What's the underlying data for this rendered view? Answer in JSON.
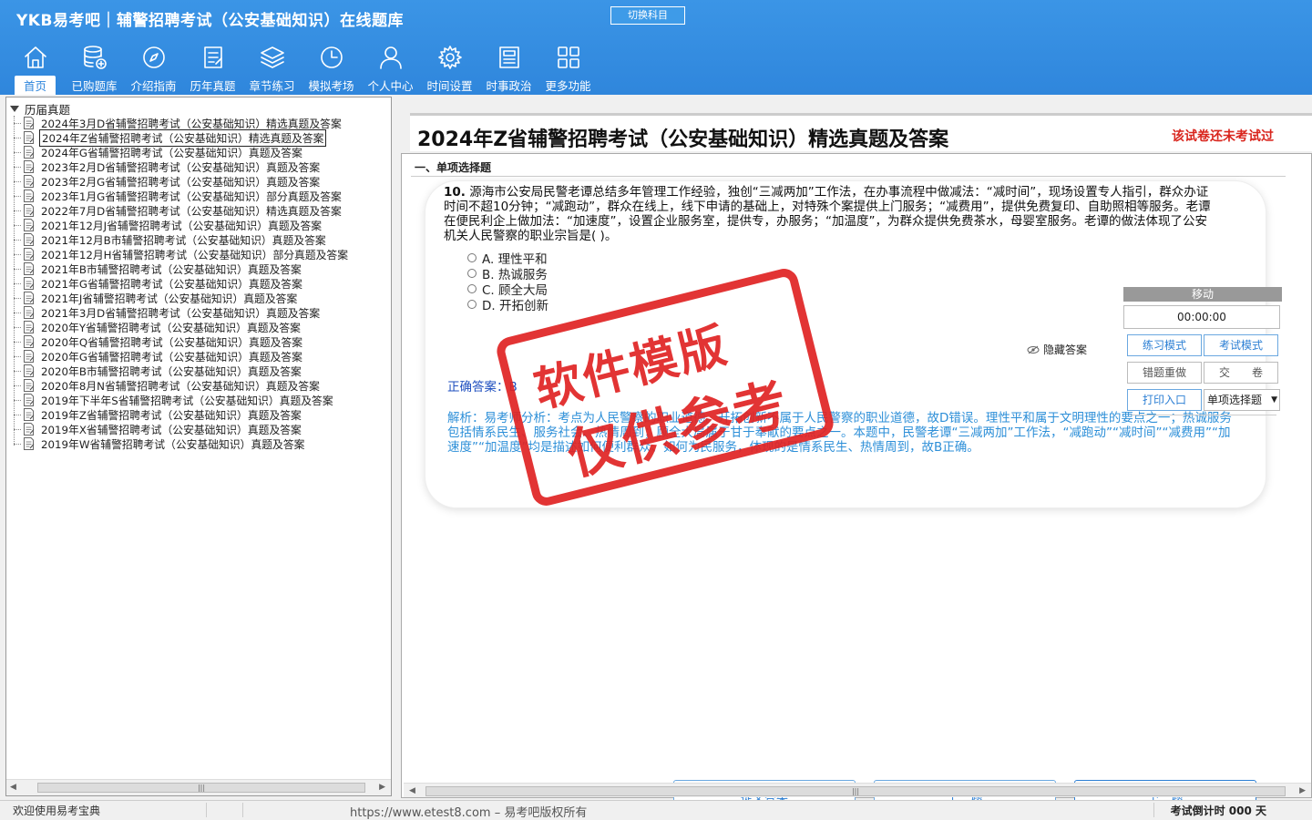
{
  "app": {
    "title": "YKB易考吧｜辅警招聘考试（公安基础知识）在线题库",
    "switch_label": "切换科目"
  },
  "toolbar": [
    {
      "label": "首页",
      "icon": "home-icon"
    },
    {
      "label": "已购题库",
      "icon": "database-icon"
    },
    {
      "label": "介绍指南",
      "icon": "compass-icon"
    },
    {
      "label": "历年真题",
      "icon": "document-list-icon"
    },
    {
      "label": "章节练习",
      "icon": "layers-icon"
    },
    {
      "label": "模拟考场",
      "icon": "clock-icon"
    },
    {
      "label": "个人中心",
      "icon": "user-icon"
    },
    {
      "label": "时间设置",
      "icon": "gear-icon"
    },
    {
      "label": "时事政治",
      "icon": "newspaper-icon"
    },
    {
      "label": "更多功能",
      "icon": "grid-icon"
    }
  ],
  "tree": {
    "root": "历届真题",
    "items": [
      "2024年3月D省辅警招聘考试（公安基础知识）精选真题及答案",
      "2024年Z省辅警招聘考试（公安基础知识）精选真题及答案",
      "2024年G省辅警招聘考试（公安基础知识）真题及答案",
      "2023年2月D省辅警招聘考试（公安基础知识）真题及答案",
      "2023年2月G省辅警招聘考试（公安基础知识）真题及答案",
      "2023年1月G省辅警招聘考试（公安基础知识）部分真题及答案",
      "2022年7月D省辅警招聘考试（公安基础知识）精选真题及答案",
      "2021年12月J省辅警招聘考试（公安基础知识）真题及答案",
      "2021年12月B市辅警招聘考试（公安基础知识）真题及答案",
      "2021年12月H省辅警招聘考试（公安基础知识）部分真题及答案",
      "2021年B市辅警招聘考试（公安基础知识）真题及答案",
      "2021年G省辅警招聘考试（公安基础知识）真题及答案",
      "2021年J省辅警招聘考试（公安基础知识）真题及答案",
      "2021年3月D省辅警招聘考试（公安基础知识）真题及答案",
      "2020年Y省辅警招聘考试（公安基础知识）真题及答案",
      "2020年Q省辅警招聘考试（公安基础知识）真题及答案",
      "2020年G省辅警招聘考试（公安基础知识）真题及答案",
      "2020年B市辅警招聘考试（公安基础知识）真题及答案",
      "2020年8月N省辅警招聘考试（公安基础知识）真题及答案",
      "2019年下半年S省辅警招聘考试（公安基础知识）真题及答案",
      "2019年Z省辅警招聘考试（公安基础知识）真题及答案",
      "2019年X省辅警招聘考试（公安基础知识）真题及答案",
      "2019年W省辅警招聘考试（公安基础知识）真题及答案"
    ],
    "selected_index": 1
  },
  "paper": {
    "title": "2024年Z省辅警招聘考试（公安基础知识）精选真题及答案",
    "status": "该试卷还未考试过",
    "section": "一、单项选择题"
  },
  "question": {
    "number": "10.",
    "text": "源海市公安局民警老谭总结多年管理工作经验，独创“三减两加”工作法，在办事流程中做减法：“减时间”，现场设置专人指引，群众办证时间不超10分钟；“减跑动”，群众在线上，线下申请的基础上，对特殊个案提供上门服务；“减费用”，提供免费复印、自助照相等服务。老谭在便民利企上做加法：“加速度”，设置企业服务室，提供专，办服务；“加温度”，为群众提供免费茶水，母婴室服务。老谭的做法体现了公安机关人民警察的职业宗旨是(  )。",
    "options": [
      "A. 理性平和",
      "B. 热诚服务",
      "C. 顾全大局",
      "D. 开拓创新"
    ],
    "hide_answer_label": "隐藏答案",
    "answer_label": "正确答案：B",
    "analysis": "解析：易考师分析：考点为人民警察的职业道德。开拓创新不属于人民警察的职业道德，故D错误。理性平和属于文明理性的要点之一；热诚服务包括情系民生、服务社会、热情周到；顾全大局属于甘于奉献的要点之一。本题中，民警老谭“三减两加”工作法，“减跑动”“减时间”“减费用”“加速度”“加温度”均是描述如何便利群众、如何为民服务，体现的是情系民生、热情周到，故B正确。"
  },
  "control": {
    "move_label": "移动",
    "timer": "00:00:00",
    "practice_mode": "练习模式",
    "exam_mode": "考试模式",
    "redo_wrong": "错题重做",
    "submit_paper": "交　　卷",
    "print_entry": "打印入口",
    "type_select": "单项选择题"
  },
  "nav": {
    "submit": "提交答案",
    "prev": "上一题",
    "next": "下一题"
  },
  "stamp": {
    "line1": "软件模版",
    "line2": "仅供参考",
    "color": "#e02323"
  },
  "status": {
    "left": "欢迎使用易考宝典",
    "center": "https://www.etest8.com – 易考吧版权所有",
    "right": "考试倒计时 000 天"
  },
  "colors": {
    "header": "#2f86dc",
    "accent": "#2c7fd4",
    "status_red": "#d9251d",
    "analysis_blue": "#2d8fd8"
  }
}
